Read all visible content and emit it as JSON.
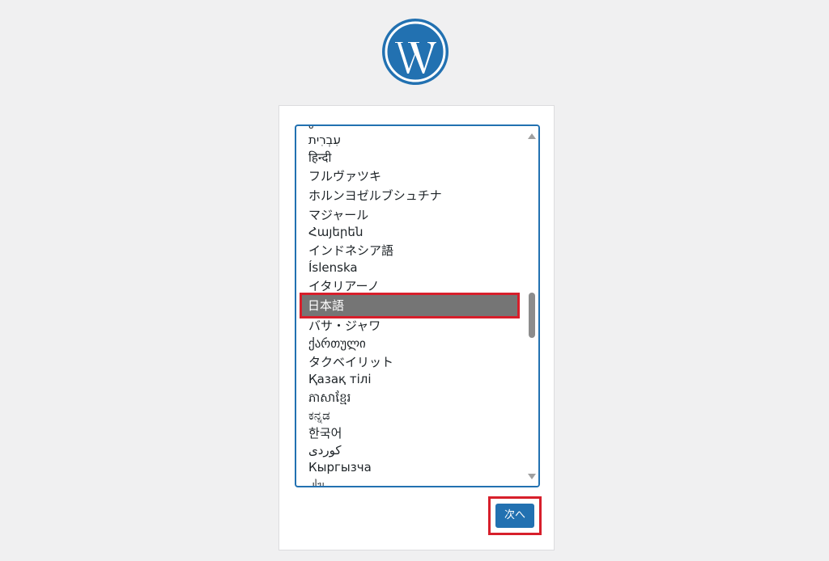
{
  "brand": {
    "logo_icon": "wordpress-logo-icon",
    "color": "#2271b1"
  },
  "language_list": {
    "items": [
      {
        "label": "עִבְרִית"
      },
      {
        "label": "हिन्दी"
      },
      {
        "label": "フルヴァツキ"
      },
      {
        "label": "ホルンヨゼルブシュチナ"
      },
      {
        "label": "マジャール"
      },
      {
        "label": "Հայերեն"
      },
      {
        "label": "インドネシア語"
      },
      {
        "label": "Íslenska"
      },
      {
        "label": "イタリアーノ"
      },
      {
        "label": "日本語",
        "selected": true
      },
      {
        "label": "バサ・ジャワ"
      },
      {
        "label": "ქართული"
      },
      {
        "label": "タクベイリット"
      },
      {
        "label": "Қазақ тілі"
      },
      {
        "label": "ភាសាខ្មែរ"
      },
      {
        "label": "ಕನ್ನಡ"
      },
      {
        "label": "한국어"
      },
      {
        "label": "كوردی"
      },
      {
        "label": "Кыргызча"
      }
    ],
    "selected": "日本語"
  },
  "next_button": {
    "label": "次へ"
  },
  "highlight_color": "#d71f2b"
}
